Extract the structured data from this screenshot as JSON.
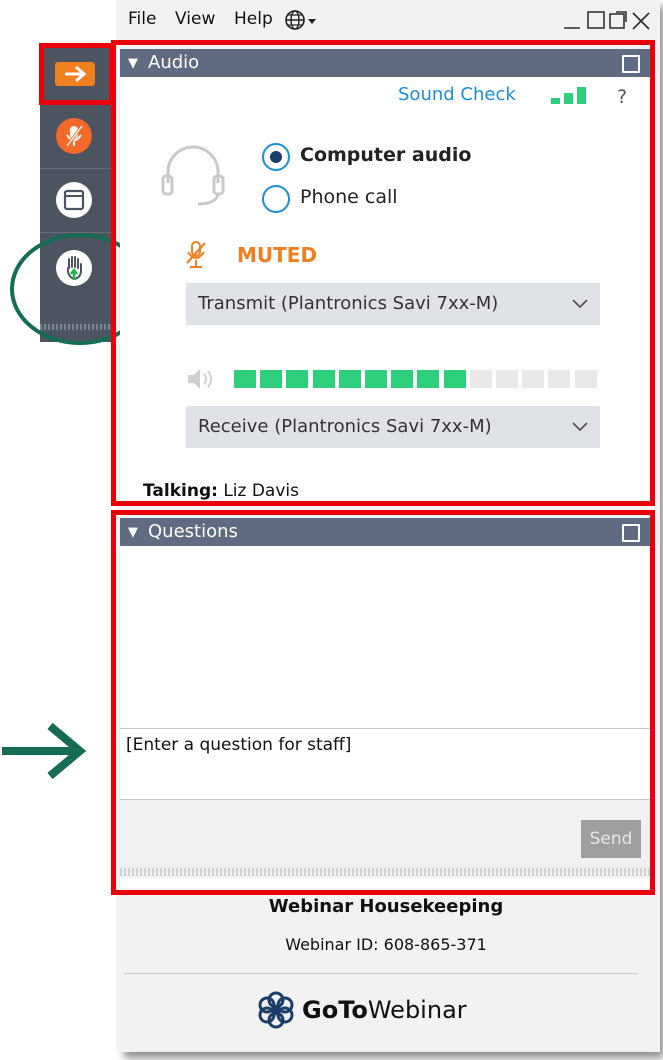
{
  "menu": {
    "file": "File",
    "view": "View",
    "help": "Help"
  },
  "audio": {
    "title": "Audio",
    "sound_check": "Sound Check",
    "help": "?",
    "computer_audio": "Computer audio",
    "phone_call": "Phone call",
    "selected_mode": "Computer audio",
    "muted_label": "MUTED",
    "transmit_device": "Transmit (Plantronics Savi 7xx-M)",
    "receive_device": "Receive (Plantronics Savi 7xx-M)",
    "input_level": 0.64,
    "talking_label": "Talking:",
    "talking_name": "Liz Davis"
  },
  "questions": {
    "title": "Questions",
    "input_value": "[Enter a question for staff]",
    "send_label": "Send"
  },
  "footer": {
    "title": "Webinar Housekeeping",
    "webinar_id": "Webinar ID: 608-865-371",
    "brand_bold": "GoTo",
    "brand_light": "Webinar"
  },
  "colors": {
    "header": "#5f6b80",
    "muted": "#f07f1e",
    "level_on": "#2ecf7a",
    "level_off": "#e8e8e8",
    "highlight_red": "#e8000a",
    "circle_green": "#156b53",
    "link": "#1a8fd6"
  }
}
